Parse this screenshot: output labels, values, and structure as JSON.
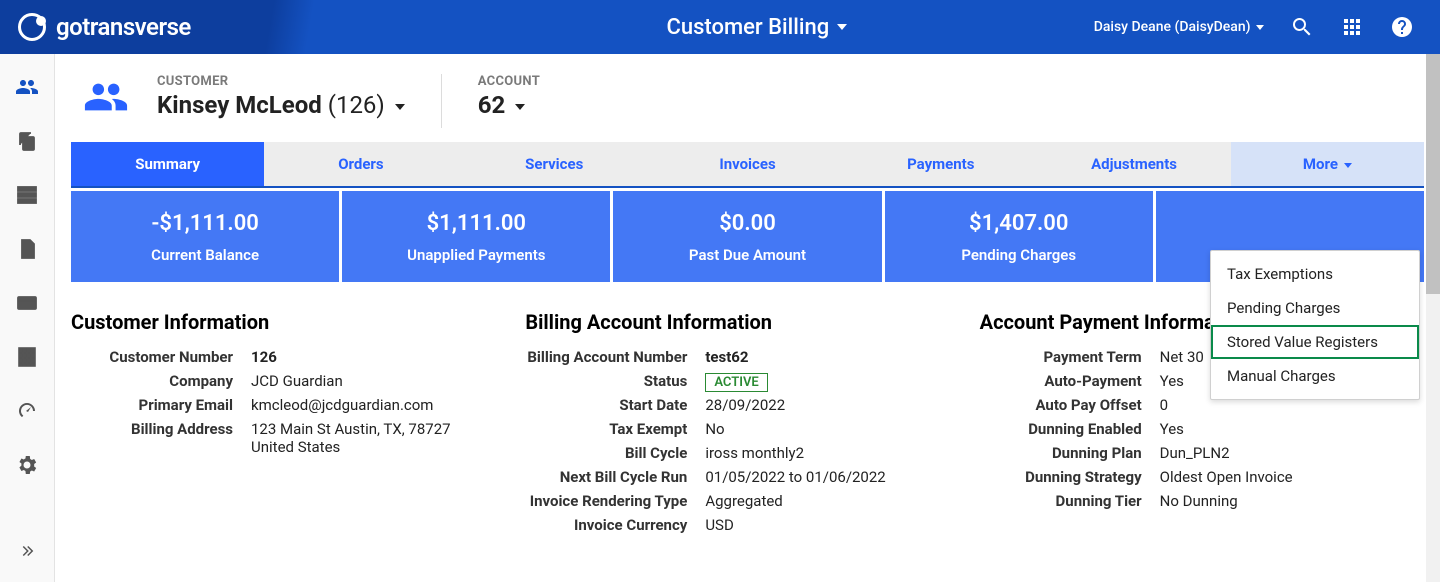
{
  "topbar": {
    "brand": "gotransverse",
    "center": "Customer Billing",
    "user": "Daisy Deane (DaisyDean)"
  },
  "head": {
    "customer_label": "CUSTOMER",
    "customer_name": "Kinsey McLeod",
    "customer_ref": "(126)",
    "account_label": "ACCOUNT",
    "account_value": "62"
  },
  "tabs": [
    {
      "label": "Summary",
      "active": true
    },
    {
      "label": "Orders"
    },
    {
      "label": "Services"
    },
    {
      "label": "Invoices"
    },
    {
      "label": "Payments"
    },
    {
      "label": "Adjustments"
    },
    {
      "label": "More",
      "more": true
    }
  ],
  "stats": [
    {
      "value": "-$1,111.00",
      "label": "Current Balance"
    },
    {
      "value": "$1,111.00",
      "label": "Unapplied Payments"
    },
    {
      "value": "$0.00",
      "label": "Past Due Amount"
    },
    {
      "value": "$1,407.00",
      "label": "Pending Charges"
    }
  ],
  "dropdown": {
    "items": [
      {
        "label": "Tax Exemptions"
      },
      {
        "label": "Pending Charges"
      },
      {
        "label": "Stored Value Registers",
        "highlight": true
      },
      {
        "label": "Manual Charges"
      }
    ]
  },
  "customer_info": {
    "title": "Customer Information",
    "rows": [
      {
        "k": "Customer Number",
        "v": "126",
        "bold": true
      },
      {
        "k": "Company",
        "v": "JCD Guardian"
      },
      {
        "k": "Primary Email",
        "v": "kmcleod@jcdguardian.com"
      },
      {
        "k": "Billing Address",
        "v": "123 Main St Austin, TX, 78727 United States"
      }
    ]
  },
  "billing_info": {
    "title": "Billing Account Information",
    "rows": [
      {
        "k": "Billing Account Number",
        "v": "test62",
        "bold": true
      },
      {
        "k": "Status",
        "v": "ACTIVE",
        "badge": true
      },
      {
        "k": "Start Date",
        "v": "28/09/2022"
      },
      {
        "k": "Tax Exempt",
        "v": "No"
      },
      {
        "k": "Bill Cycle",
        "v": "iross monthly2"
      },
      {
        "k": "Next Bill Cycle Run",
        "v": "01/05/2022 to 01/06/2022"
      },
      {
        "k": "Invoice Rendering Type",
        "v": "Aggregated"
      },
      {
        "k": "Invoice Currency",
        "v": "USD"
      }
    ]
  },
  "payment_info": {
    "title": "Account Payment Information",
    "rows": [
      {
        "k": "Payment Term",
        "v": "Net 30"
      },
      {
        "k": "Auto-Payment",
        "v": "Yes"
      },
      {
        "k": "Auto Pay Offset",
        "v": "0"
      },
      {
        "k": "Dunning Enabled",
        "v": "Yes"
      },
      {
        "k": "Dunning Plan",
        "v": "Dun_PLN2"
      },
      {
        "k": "Dunning Strategy",
        "v": "Oldest Open Invoice"
      },
      {
        "k": "Dunning Tier",
        "v": "No Dunning"
      }
    ]
  },
  "sidebar_icons": [
    {
      "name": "customers-icon",
      "active": true
    },
    {
      "name": "copy-icon"
    },
    {
      "name": "server-icon"
    },
    {
      "name": "document-icon"
    },
    {
      "name": "credit-card-icon"
    },
    {
      "name": "calculator-icon"
    },
    {
      "name": "gauge-icon"
    },
    {
      "name": "gear-icon"
    }
  ]
}
